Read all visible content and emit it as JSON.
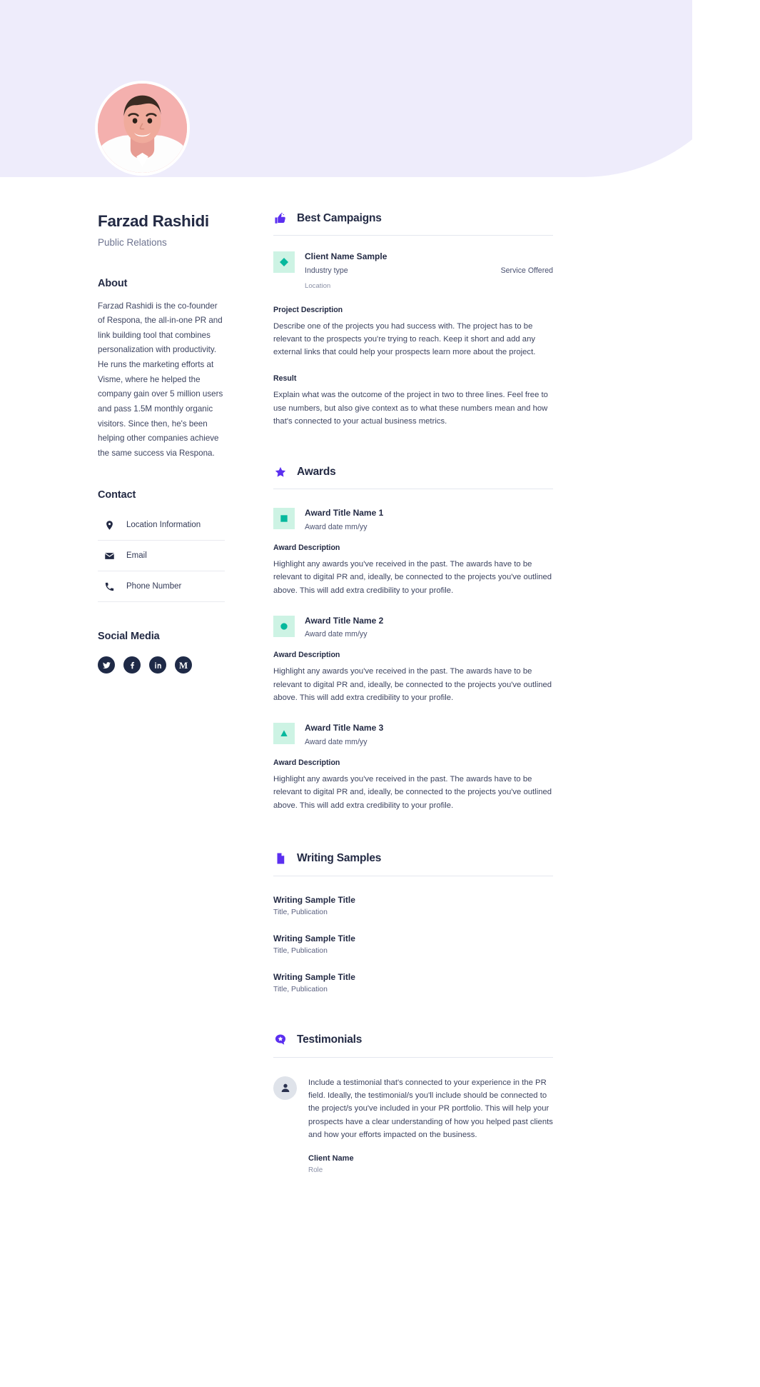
{
  "profile": {
    "name": "Farzad Rashidi",
    "role": "Public Relations",
    "avatar_alt": "profile-photo"
  },
  "sidebar": {
    "about_heading": "About",
    "about_text": "Farzad Rashidi is the co-founder of Respona, the all-in-one PR and link building tool that combines personalization with productivity. He runs the marketing efforts at Visme, where he helped the company gain over 5 million users and pass 1.5M monthly organic visitors. Since then, he's been helping other companies achieve the same success via Respona.",
    "contact_heading": "Contact",
    "contact_items": [
      {
        "icon": "location-pin-icon",
        "label": "Location Information"
      },
      {
        "icon": "envelope-icon",
        "label": "Email"
      },
      {
        "icon": "phone-icon",
        "label": "Phone Number"
      }
    ],
    "social_heading": "Social Media",
    "social_items": [
      {
        "icon": "twitter-icon",
        "name": "Twitter"
      },
      {
        "icon": "facebook-icon",
        "name": "Facebook"
      },
      {
        "icon": "linkedin-icon",
        "name": "LinkedIn"
      },
      {
        "icon": "medium-icon",
        "name": "Medium"
      }
    ]
  },
  "main": {
    "campaigns": {
      "title": "Best Campaigns",
      "icon": "thumbs-up-icon",
      "card": {
        "shape": "diamond",
        "client_name": "Client Name Sample",
        "industry": "Industry type",
        "service": "Service Offered",
        "location": "Location",
        "project_description_label": "Project Description",
        "project_description_text": "Describe one of the projects you had success with. The project has to be relevant to the prospects you're trying to reach. Keep it short and add any external links that could help your prospects learn more about the project.",
        "result_label": "Result",
        "result_text": "Explain what was the outcome of the project in two to three lines. Feel free to use numbers, but also give context as to what these numbers mean and how that's connected to your actual business metrics."
      }
    },
    "awards": {
      "title": "Awards",
      "icon": "star-icon",
      "items": [
        {
          "shape": "square",
          "title": "Award Title Name 1",
          "date": "Award date mm/yy",
          "description_label": "Award Description",
          "description_text": "Highlight any awards you've received in the past. The awards have to be relevant to digital PR and, ideally, be connected to the projects you've outlined above. This will add extra credibility to your profile."
        },
        {
          "shape": "circle",
          "title": "Award Title Name 2",
          "date": "Award date mm/yy",
          "description_label": "Award Description",
          "description_text": "Highlight any awards you've received in the past. The awards have to be relevant to digital PR and, ideally, be connected to the projects you've outlined above. This will add extra credibility to your profile."
        },
        {
          "shape": "triangle",
          "title": "Award Title Name 3",
          "date": "Award date mm/yy",
          "description_label": "Award Description",
          "description_text": "Highlight any awards you've received in the past. The awards have to be relevant to digital PR and, ideally, be connected to the projects you've outlined above. This will add extra credibility to your profile."
        }
      ]
    },
    "writing_samples": {
      "title": "Writing Samples",
      "icon": "document-icon",
      "items": [
        {
          "title": "Writing Sample Title",
          "subtitle": "Title, Publication"
        },
        {
          "title": "Writing Sample Title",
          "subtitle": "Title, Publication"
        },
        {
          "title": "Writing Sample Title",
          "subtitle": "Title, Publication"
        }
      ]
    },
    "testimonials": {
      "title": "Testimonials",
      "icon": "quote-bubble-icon",
      "item": {
        "avatar": "person-avatar-icon",
        "text": "Include a testimonial that's connected to your experience in the PR field. Ideally, the testimonial/s you'll include should be connected to the project/s you've included in your PR portfolio. This will help your prospects have a clear understanding of how you helped past clients and how your efforts impacted on the business.",
        "client_name": "Client Name",
        "client_role": "Role"
      }
    }
  },
  "colors": {
    "accent_purple": "#5b2ff0",
    "banner_lavender": "#eeecfb",
    "teal": "#06b89d",
    "teal_bg": "#cdf3e4",
    "text_dark": "#232a44"
  }
}
